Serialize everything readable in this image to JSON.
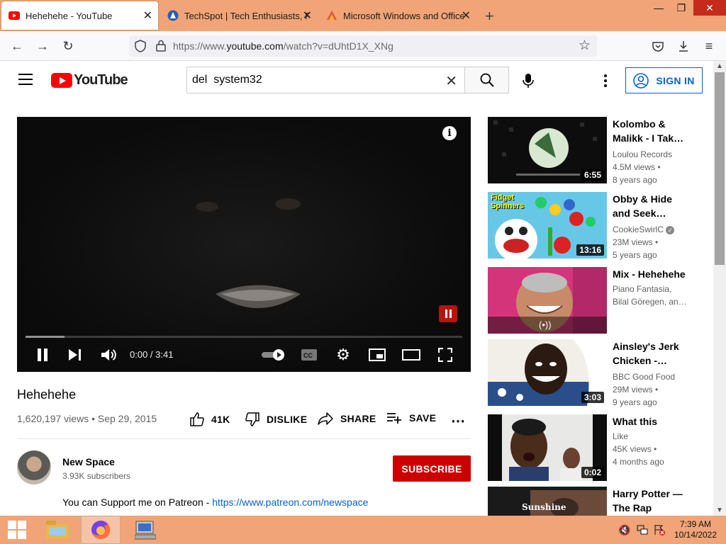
{
  "browser": {
    "tabs": [
      {
        "title": "Hehehehe - YouTube",
        "active": true,
        "icon": "youtube-favicon"
      },
      {
        "title": "TechSpot | Tech Enthusiasts, Po",
        "active": false,
        "icon": "techspot-favicon"
      },
      {
        "title": "Microsoft Windows and Office",
        "active": false,
        "icon": "ms-favicon"
      }
    ],
    "url_prefix": "https://www.",
    "url_domain": "youtube.com",
    "url_path": "/watch?v=dUhtD1X_XNg"
  },
  "youtube": {
    "logo_text": "YouTube",
    "search_value": "del  system32",
    "signin_label": "SIGN IN"
  },
  "player": {
    "time": "0:00 / 3:41",
    "loaded_fraction": 0.09
  },
  "video": {
    "title": "Hehehehe",
    "meta": "1,620,197 views • Sep 29, 2015",
    "likes": "41K",
    "dislike_label": "DISLIKE",
    "share_label": "SHARE",
    "save_label": "SAVE",
    "channel_name": "New Space",
    "subscribers": "3.93K subscribers",
    "subscribe_label": "SUBSCRIBE",
    "description_text": "You can Support me on Patreon - ",
    "description_link": "https://www.patreon.com/newspace"
  },
  "recommendations": [
    {
      "title_line1": "Kolombo &",
      "title_line2": "Malikk - I Tak…",
      "channel": "Loulou Records",
      "views": "4.5M views •",
      "age": "8 years ago",
      "duration": "6:55"
    },
    {
      "title_line1": "Obby & Hide",
      "title_line2": "and Seek…",
      "channel": "CookieSwirlC",
      "verified": true,
      "views": "23M views •",
      "age": "5 years ago",
      "duration": "13:16"
    },
    {
      "title_line1": "Mix - Hehehehe",
      "title_line2": "",
      "channel": "Piano Fantasia,",
      "views": "Bilal Göregen, an…",
      "age": "",
      "duration": "",
      "live_icon": "(•))"
    },
    {
      "title_line1": "Ainsley's Jerk",
      "title_line2": "Chicken -…",
      "channel": "BBC Good Food",
      "views": "29M views •",
      "age": "9 years ago",
      "duration": "3:03"
    },
    {
      "title_line1": "What this",
      "title_line2": "",
      "channel": "Like",
      "views": "45K views •",
      "age": "4 months ago",
      "duration": "0:02"
    },
    {
      "title_line1": "Harry Potter —",
      "title_line2": "The Rap PART…",
      "channel": "",
      "views": "",
      "age": "",
      "duration": "",
      "thumb_text": "Sunshine"
    }
  ],
  "thumb_texts": {
    "fidget": "Fidget\nSpinners"
  },
  "taskbar": {
    "time": "7:39 AM",
    "date": "10/14/2022"
  },
  "colors": {
    "accent": "#f0a477",
    "youtube_red": "#ff0000",
    "subscribe_red": "#cc0000",
    "link_blue": "#065fd4"
  }
}
